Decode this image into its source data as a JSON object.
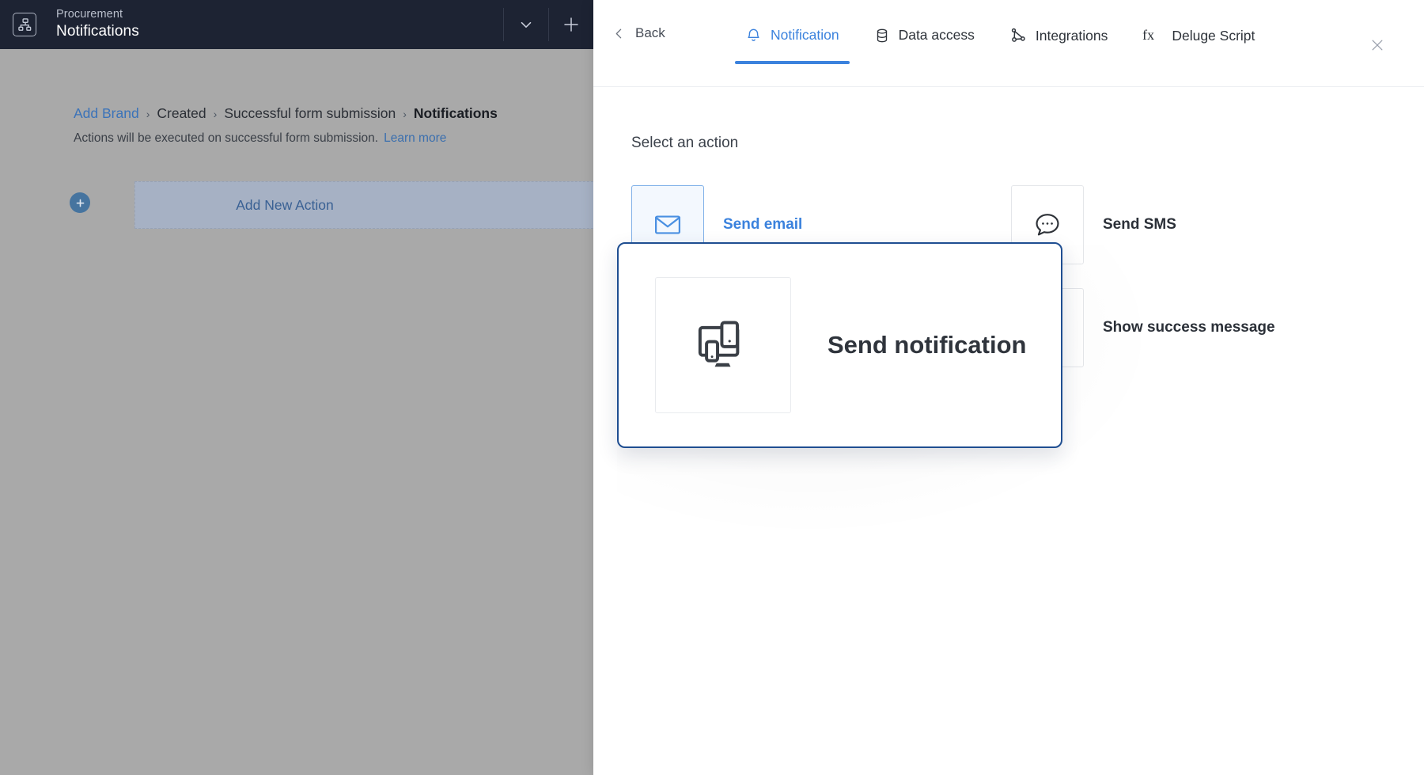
{
  "colors": {
    "topbar_bg": "#1d2333",
    "overlay_gray": "#a9a9a9",
    "accent_blue": "#3b82dd",
    "link_blue": "#3b73b9",
    "drag_border": "#1f4e91",
    "panel_bg": "#ffffff",
    "add_bar_bg": "#a6b1c4"
  },
  "topbar": {
    "logo_icon": "flowchart-icon",
    "app_name": "Procurement",
    "page_title": "Notifications",
    "dropdown_icon": "chevron-down-icon",
    "add_icon": "plus-icon"
  },
  "background_page": {
    "breadcrumb": [
      {
        "label": "Add Brand",
        "is_link": true,
        "current": false
      },
      {
        "label": "Created",
        "is_link": false,
        "current": false
      },
      {
        "label": "Successful form submission",
        "is_link": false,
        "current": false
      },
      {
        "label": "Notifications",
        "is_link": false,
        "current": true
      }
    ],
    "breadcrumb_separator": "›",
    "description": "Actions will be executed on successful form submission.",
    "learn_more_label": "Learn more",
    "add_action": {
      "plus_icon": "plus-circle-icon",
      "label": "Add New Action"
    }
  },
  "panel": {
    "back": {
      "icon": "chevron-left-icon",
      "label": "Back"
    },
    "tabs": [
      {
        "label": "Notification",
        "icon": "bell-icon",
        "active": true
      },
      {
        "label": "Data access",
        "icon": "database-icon",
        "active": false
      },
      {
        "label": "Integrations",
        "icon": "nodes-icon",
        "active": false
      },
      {
        "label": "Deluge Script",
        "icon": "fx-icon",
        "active": false
      }
    ],
    "close_icon": "close-icon",
    "section_title": "Select an action",
    "actions": [
      {
        "label": "Send email",
        "icon": "envelope-icon",
        "selected": true,
        "muted": false
      },
      {
        "label": "Send SMS",
        "icon": "chat-bubble-icon",
        "selected": false,
        "muted": false
      },
      {
        "label": "Send notification",
        "icon": "devices-icon",
        "selected": false,
        "muted": true
      },
      {
        "label": "Show success message",
        "icon": "check-square-icon",
        "selected": false,
        "muted": false
      }
    ],
    "dragging_card": {
      "label": "Send notification",
      "icon": "devices-icon"
    }
  }
}
